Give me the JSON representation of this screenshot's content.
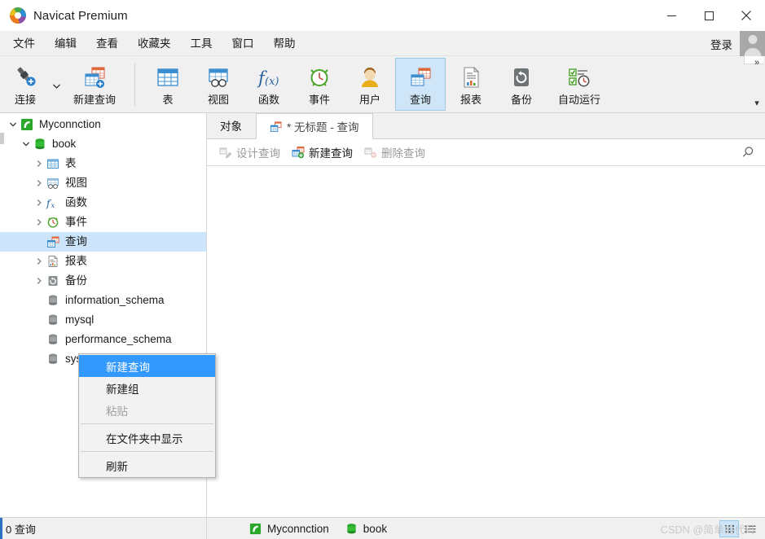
{
  "window": {
    "title": "Navicat Premium",
    "app_icon": "navicat-logo-icon",
    "minimize_label": "—",
    "maximize_label": "□",
    "close_label": "✕"
  },
  "menubar": {
    "items": [
      {
        "label": "文件",
        "name": "menu-file"
      },
      {
        "label": "编辑",
        "name": "menu-edit"
      },
      {
        "label": "查看",
        "name": "menu-view"
      },
      {
        "label": "收藏夹",
        "name": "menu-favorites"
      },
      {
        "label": "工具",
        "name": "menu-tools"
      },
      {
        "label": "窗口",
        "name": "menu-window"
      },
      {
        "label": "帮助",
        "name": "menu-help"
      }
    ],
    "login_label": "登录"
  },
  "ribbon": {
    "buttons": [
      {
        "label": "连接",
        "name": "ribbon-connection",
        "icon": "connection-icon",
        "active": false
      },
      {
        "label": "新建查询",
        "name": "ribbon-new-query",
        "icon": "new-query-icon",
        "active": false
      },
      {
        "label": "表",
        "name": "ribbon-table",
        "icon": "table-icon",
        "active": false
      },
      {
        "label": "视图",
        "name": "ribbon-view",
        "icon": "view-icon",
        "active": false
      },
      {
        "label": "函数",
        "name": "ribbon-function",
        "icon": "function-fx-icon",
        "active": false
      },
      {
        "label": "事件",
        "name": "ribbon-event",
        "icon": "event-clock-icon",
        "active": false
      },
      {
        "label": "用户",
        "name": "ribbon-user",
        "icon": "user-icon",
        "active": false
      },
      {
        "label": "查询",
        "name": "ribbon-query",
        "icon": "query-icon",
        "active": true
      },
      {
        "label": "报表",
        "name": "ribbon-report",
        "icon": "report-icon",
        "active": false
      },
      {
        "label": "备份",
        "name": "ribbon-backup",
        "icon": "backup-icon",
        "active": false
      },
      {
        "label": "自动运行",
        "name": "ribbon-automation",
        "icon": "automation-icon",
        "active": false
      }
    ],
    "overflow_label": "»",
    "expand_label": "▾"
  },
  "sidebar": {
    "tree": [
      {
        "label": "Myconnction",
        "name": "tree-item-connection",
        "icon": "connection-green-icon",
        "indent": 0,
        "twisty": "expanded",
        "selected": false
      },
      {
        "label": "book",
        "name": "tree-item-database-book",
        "icon": "database-icon",
        "indent": 1,
        "twisty": "expanded",
        "selected": false
      },
      {
        "label": "表",
        "name": "tree-item-tables",
        "icon": "table-icon",
        "indent": 2,
        "twisty": "collapsed",
        "selected": false
      },
      {
        "label": "视图",
        "name": "tree-item-views",
        "icon": "view-icon",
        "indent": 2,
        "twisty": "collapsed",
        "selected": false
      },
      {
        "label": "函数",
        "name": "tree-item-functions",
        "icon": "function-fx-icon",
        "indent": 2,
        "twisty": "collapsed",
        "selected": false
      },
      {
        "label": "事件",
        "name": "tree-item-events",
        "icon": "event-clock-icon",
        "indent": 2,
        "twisty": "collapsed",
        "selected": false
      },
      {
        "label": "查询",
        "name": "tree-item-queries",
        "icon": "query-icon",
        "indent": 2,
        "twisty": "none",
        "selected": true
      },
      {
        "label": "报表",
        "name": "tree-item-reports",
        "icon": "report-icon",
        "indent": 2,
        "twisty": "collapsed",
        "selected": false
      },
      {
        "label": "备份",
        "name": "tree-item-backups",
        "icon": "backup-icon",
        "indent": 2,
        "twisty": "collapsed",
        "selected": false
      },
      {
        "label": "information_schema",
        "name": "tree-item-database-information-schema",
        "icon": "database-gray-icon",
        "indent": 2,
        "twisty": "none",
        "selected": false
      },
      {
        "label": "mysql",
        "name": "tree-item-database-mysql",
        "icon": "database-gray-icon",
        "indent": 2,
        "twisty": "none",
        "selected": false
      },
      {
        "label": "performance_schema",
        "name": "tree-item-database-performance-schema",
        "icon": "database-gray-icon",
        "indent": 2,
        "twisty": "none",
        "selected": false
      },
      {
        "label": "sys",
        "name": "tree-item-database-sys",
        "icon": "database-gray-icon",
        "indent": 2,
        "twisty": "none",
        "selected": false
      }
    ]
  },
  "context_menu": {
    "items": [
      {
        "label": "新建查询",
        "name": "ctx-new-query",
        "state": "highlight"
      },
      {
        "label": "新建组",
        "name": "ctx-new-group",
        "state": "normal"
      },
      {
        "label": "粘贴",
        "name": "ctx-paste",
        "state": "disabled"
      },
      {
        "label": "在文件夹中显示",
        "name": "ctx-show-in-folder",
        "state": "normal"
      },
      {
        "label": "刷新",
        "name": "ctx-refresh",
        "state": "normal"
      }
    ]
  },
  "main": {
    "tabs": [
      {
        "label": "对象",
        "name": "tab-objects",
        "active": false,
        "icon": "none"
      },
      {
        "label": "* 无标题 - 查询",
        "name": "tab-untitled-query",
        "active": true,
        "icon": "query-icon"
      }
    ],
    "toolbar": [
      {
        "label": "设计查询",
        "name": "design-query-button",
        "icon": "design-query-icon",
        "enabled": false
      },
      {
        "label": "新建查询",
        "name": "new-query-button",
        "icon": "new-query-icon",
        "enabled": true
      },
      {
        "label": "删除查询",
        "name": "delete-query-button",
        "icon": "delete-query-icon",
        "enabled": false
      }
    ],
    "search_icon": "search-icon"
  },
  "statusbar": {
    "count_label": "0 查询",
    "connection_label": "Myconnction",
    "database_label": "book",
    "view_grid_icon": "grid-view-icon",
    "view_list_icon": "list-view-icon"
  },
  "watermark": {
    "text": "CSDN @简单的代码"
  },
  "colors": {
    "accent_blue": "#3399ff",
    "selection_blue": "#cce5fb",
    "ribbon_active": "#cee6f7",
    "chrome_gray": "#f0f0f0",
    "db_green": "#2aa82a",
    "table_blue": "#3b8fd0",
    "query_orange": "#e06a3a"
  }
}
